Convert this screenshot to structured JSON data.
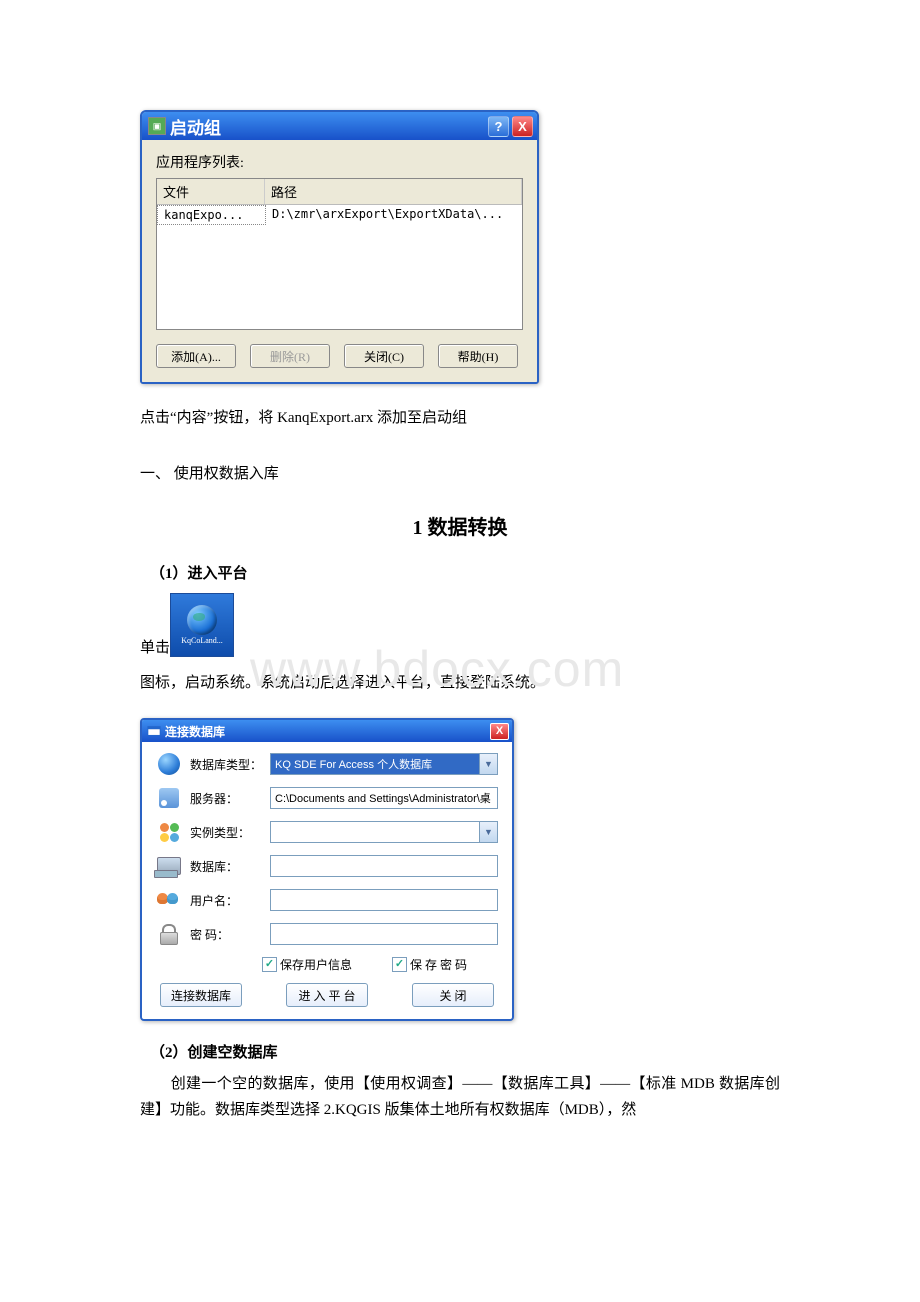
{
  "watermark": "www.bdocx.com",
  "dlg1": {
    "title": "启动组",
    "help_tooltip": "?",
    "close_tooltip": "X",
    "list_label": "应用程序列表:",
    "cols": {
      "file": "文件",
      "path": "路径"
    },
    "rows": [
      {
        "file": "kanqExpo...",
        "path": "D:\\zmr\\arxExport\\ExportXData\\..."
      }
    ],
    "buttons": {
      "add": "添加(A)...",
      "remove": "删除(R)",
      "close": "关闭(C)",
      "help": "帮助(H)"
    }
  },
  "text": {
    "p1": "点击“内容”按钮，将 KanqExport.arx 添加至启动组",
    "sec1": "一、 使用权数据入库",
    "h1": "1 数据转换",
    "sub1": "（1）进入平台",
    "click_pre": "单击",
    "desk_caption": "KqCoLand...",
    "p2": "图标，启动系统。系统启动后选择进入平台，直接登陆系统。",
    "sub2": "（2）创建空数据库",
    "p3_indent": "　　创建一个空的数据库，使用【使用权调查】——【数据库工具】——【标准 MDB 数据库创建】功能。数据库类型选择 2.KQGIS 版集体土地所有权数据库（MDB），然"
  },
  "dlg2": {
    "title": "连接数据库",
    "labels": {
      "dbtype": "数据库类型：",
      "server": "服务器：",
      "instance": "实例类型：",
      "database": "数据库：",
      "username": "用户名：",
      "password": "密 码："
    },
    "values": {
      "dbtype": "KQ SDE For Access 个人数据库",
      "server": "C:\\Documents and Settings\\Administrator\\桌",
      "instance": "",
      "database": "",
      "username": "",
      "password": ""
    },
    "checks": {
      "save_user": "保存用户信息",
      "save_pwd": "保 存 密 码"
    },
    "buttons": {
      "connect": "连接数据库",
      "enter": "进 入 平 台",
      "close": "关  闭"
    }
  }
}
